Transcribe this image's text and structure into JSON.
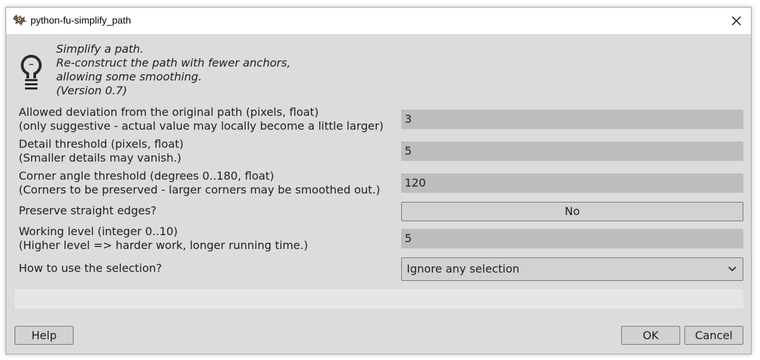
{
  "window": {
    "title": "python-fu-simplify_path",
    "app_icon": "gimp-wilber-icon",
    "close_icon": "close-icon"
  },
  "description": {
    "icon": "lightbulb-icon",
    "lines": [
      "Simplify a path.",
      "Re-construct the path with fewer anchors,",
      "allowing some smoothing.",
      "(Version 0.7)"
    ]
  },
  "params": {
    "deviation": {
      "label_1": "Allowed deviation from the original path (pixels, float)",
      "label_2": "(only suggestive - actual value may locally become a little larger)",
      "value": "3"
    },
    "detail": {
      "label_1": "Detail threshold (pixels, float)",
      "label_2": "(Smaller details may vanish.)",
      "value": "5"
    },
    "corner": {
      "label_1": "Corner angle threshold (degrees 0..180, float)",
      "label_2": "(Corners to be preserved - larger corners may be smoothed out.)",
      "value": "120"
    },
    "straight": {
      "label": "Preserve straight edges?",
      "value": "No"
    },
    "level": {
      "label_1": "Working level (integer 0..10)",
      "label_2": "(Higher level => harder work, longer running time.)",
      "value": "5"
    },
    "selection": {
      "label": "How to use the selection?",
      "value": "Ignore any selection",
      "chevron_icon": "chevron-down-icon"
    }
  },
  "buttons": {
    "help": "Help",
    "ok": "OK",
    "cancel": "Cancel"
  }
}
